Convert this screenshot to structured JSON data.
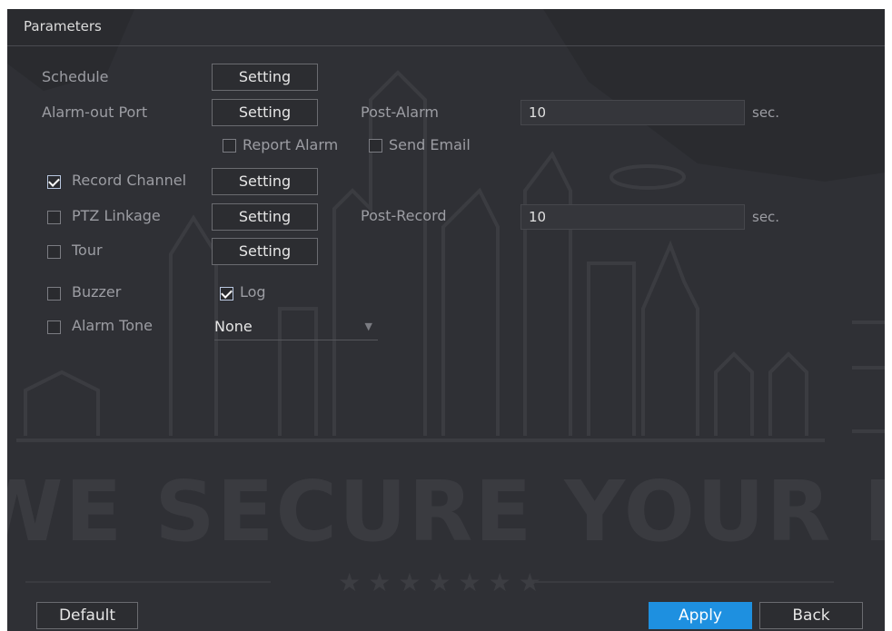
{
  "title": "Parameters",
  "schedule": {
    "label": "Schedule",
    "button": "Setting"
  },
  "alarm_out": {
    "label": "Alarm-out Port",
    "button": "Setting",
    "post_label": "Post-Alarm",
    "post_value": "10",
    "unit": "sec."
  },
  "report_alarm": {
    "label": "Report Alarm",
    "checked": false
  },
  "send_email": {
    "label": "Send Email",
    "checked": false
  },
  "record_channel": {
    "label": "Record Channel",
    "checked": true,
    "button": "Setting"
  },
  "ptz_linkage": {
    "label": "PTZ Linkage",
    "checked": false,
    "button": "Setting",
    "post_label": "Post-Record",
    "post_value": "10",
    "unit": "sec."
  },
  "tour": {
    "label": "Tour",
    "checked": false,
    "button": "Setting"
  },
  "buzzer": {
    "label": "Buzzer",
    "checked": false
  },
  "log": {
    "label": "Log",
    "checked": true
  },
  "alarm_tone": {
    "label": "Alarm Tone",
    "checked": false,
    "value": "None"
  },
  "watermark": {
    "text": "WE SECURE YOUR LIFE"
  },
  "footer": {
    "default": "Default",
    "apply": "Apply",
    "back": "Back"
  },
  "colors": {
    "background": "#2f3035",
    "accent": "#1e90e0"
  },
  "icons": {
    "checkbox": "checkbox-icon",
    "dropdown": "chevron-down-icon"
  }
}
